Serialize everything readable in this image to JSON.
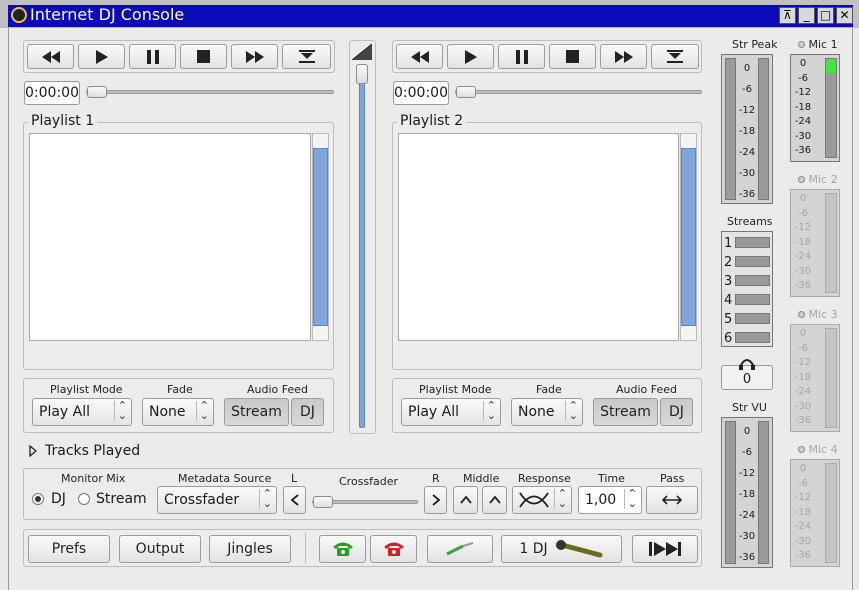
{
  "window": {
    "title": "Internet DJ Console",
    "controls": [
      "⊼",
      "_",
      "□",
      "✕"
    ]
  },
  "player_left": {
    "time": "0:00:00",
    "playlist_title": "Playlist 1",
    "playlist_mode_label": "Playlist Mode",
    "playlist_mode_value": "Play All",
    "fade_label": "Fade",
    "fade_value": "None",
    "audio_feed_label": "Audio Feed",
    "stream_label": "Stream",
    "dj_label": "DJ"
  },
  "player_right": {
    "time": "0:00:00",
    "playlist_title": "Playlist 2",
    "playlist_mode_label": "Playlist Mode",
    "playlist_mode_value": "Play All",
    "fade_label": "Fade",
    "fade_value": "None",
    "audio_feed_label": "Audio Feed",
    "stream_label": "Stream",
    "dj_label": "DJ"
  },
  "tracks_played": "Tracks Played",
  "mix": {
    "monitor_mix_label": "Monitor Mix",
    "dj_option": "DJ",
    "stream_option": "Stream",
    "metadata_label": "Metadata Source",
    "metadata_value": "Crossfader",
    "l_label": "L",
    "crossfader_label": "Crossfader",
    "r_label": "R",
    "middle_label": "Middle",
    "response_label": "Response",
    "time_label": "Time",
    "time_value": "1,00",
    "pass_label": "Pass"
  },
  "bottom": {
    "prefs": "Prefs",
    "output": "Output",
    "jingles": "Jingles",
    "dj_count": "1 DJ"
  },
  "meters": {
    "str_peak_label": "Str Peak",
    "streams_label": "Streams",
    "stream_numbers": [
      "1",
      "2",
      "3",
      "4",
      "5",
      "6"
    ],
    "headphone_count": "0",
    "str_vu_label": "Str VU",
    "scale": [
      "0",
      "-6",
      "-12",
      "-18",
      "-24",
      "-30",
      "-36"
    ],
    "mic1": "Mic 1",
    "mic2": "Mic 2",
    "mic3": "Mic 3",
    "mic4": "Mic 4"
  },
  "colors": {
    "titlebar": "#0a0ab8",
    "scroll_thumb": "#7fa7dc",
    "mic_active": "#3ee83e",
    "phone_green": "#21a221",
    "phone_red": "#d42020"
  }
}
